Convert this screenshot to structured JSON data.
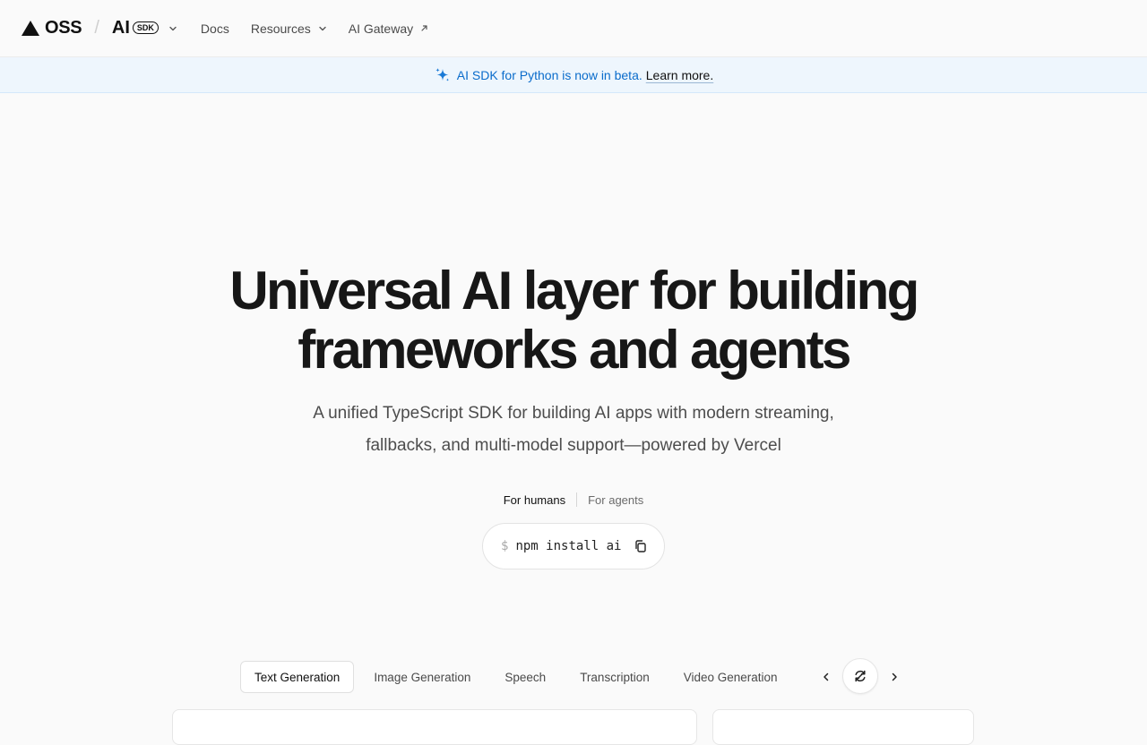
{
  "nav": {
    "brand": "OSS",
    "separator": "/",
    "product_name": "AI",
    "product_badge": "SDK",
    "links": [
      {
        "label": "Docs",
        "icon": ""
      },
      {
        "label": "Resources",
        "icon": "chevron-down-icon"
      },
      {
        "label": "AI Gateway",
        "icon": "arrow-up-right-icon"
      }
    ]
  },
  "banner": {
    "icon": "sparkle-icon",
    "text": "AI SDK for Python is now in beta.",
    "link": "Learn more."
  },
  "hero": {
    "title_line1": "Universal AI layer for building",
    "title_line2": "frameworks and agents",
    "subtitle_line1": "A unified TypeScript SDK for building AI apps with modern streaming,",
    "subtitle_line2": "fallbacks, and multi-model support—powered by Vercel"
  },
  "audience_toggle": {
    "options": [
      "For humans",
      "For agents"
    ],
    "active": "For humans"
  },
  "install": {
    "prompt": "$",
    "command": "npm install ai",
    "copy_icon": "copy-icon"
  },
  "tabs": {
    "items": [
      "Text Generation",
      "Image Generation",
      "Speech",
      "Transcription",
      "Video Generation"
    ],
    "active": "Text Generation",
    "prev_icon": "chevron-left-icon",
    "cycle_icon": "refresh-cycle-icon",
    "next_icon": "chevron-right-icon"
  },
  "colors": {
    "page_bg": "#fafafa",
    "banner_bg": "#eef6fd",
    "banner_text": "#0a6ccb",
    "text_primary": "#171717",
    "text_secondary": "#4d4d4d"
  }
}
